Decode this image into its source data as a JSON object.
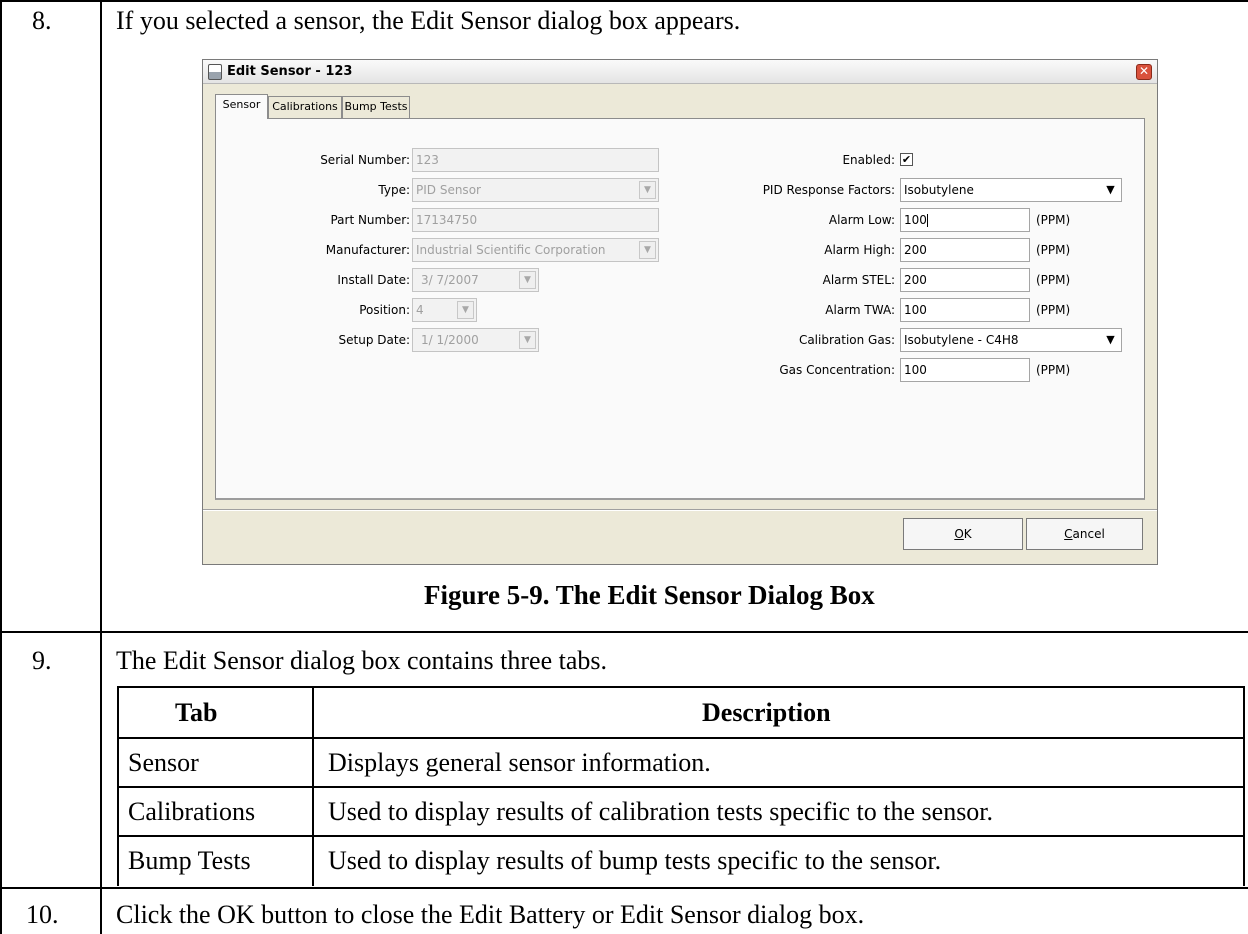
{
  "steps": [
    {
      "number": "8.",
      "text": "If you selected a sensor, the Edit Sensor dialog box appears."
    },
    {
      "number": "9.",
      "text": "The Edit Sensor dialog box contains three tabs."
    },
    {
      "number": "10.",
      "text": "Click the OK button to close the Edit Battery or Edit Sensor dialog box."
    }
  ],
  "figure_caption": "Figure 5-9.  The Edit Sensor Dialog Box",
  "dialog": {
    "title": "Edit Sensor - 123",
    "tabs": [
      "Sensor",
      "Calibrations",
      "Bump Tests"
    ],
    "left": {
      "serial_label": "Serial Number:",
      "serial_value": "123",
      "type_label": "Type:",
      "type_value": "PID Sensor",
      "part_label": "Part Number:",
      "part_value": "17134750",
      "manufacturer_label": "Manufacturer:",
      "manufacturer_value": "Industrial Scientific Corporation",
      "install_label": "Install Date:",
      "install_value": "3/ 7/2007",
      "position_label": "Position:",
      "position_value": "4",
      "setup_label": "Setup Date:",
      "setup_value": "1/ 1/2000"
    },
    "right": {
      "enabled_label": "Enabled:",
      "enabled_checked": "✔",
      "pid_label": "PID Response Factors:",
      "pid_value": "Isobutylene",
      "alarm_low_label": "Alarm Low:",
      "alarm_low_value": "100",
      "alarm_high_label": "Alarm High:",
      "alarm_high_value": "200",
      "alarm_stel_label": "Alarm STEL:",
      "alarm_stel_value": "200",
      "alarm_twa_label": "Alarm TWA:",
      "alarm_twa_value": "100",
      "cal_gas_label": "Calibration Gas:",
      "cal_gas_value": "Isobutylene - C4H8",
      "gas_conc_label": "Gas Concentration:",
      "gas_conc_value": "100",
      "unit": "(PPM)"
    },
    "ok_key": "O",
    "ok_rest": "K",
    "cancel_key": "C",
    "cancel_rest": "ancel"
  },
  "tab_table": {
    "headers": [
      "Tab",
      "Description"
    ],
    "rows": [
      {
        "tab": "Sensor",
        "description": "Displays general sensor information."
      },
      {
        "tab": "Calibrations",
        "description": "Used to display results of calibration tests specific to the sensor."
      },
      {
        "tab": "Bump Tests",
        "description": "Used to display results of bump tests specific to the sensor."
      }
    ]
  }
}
